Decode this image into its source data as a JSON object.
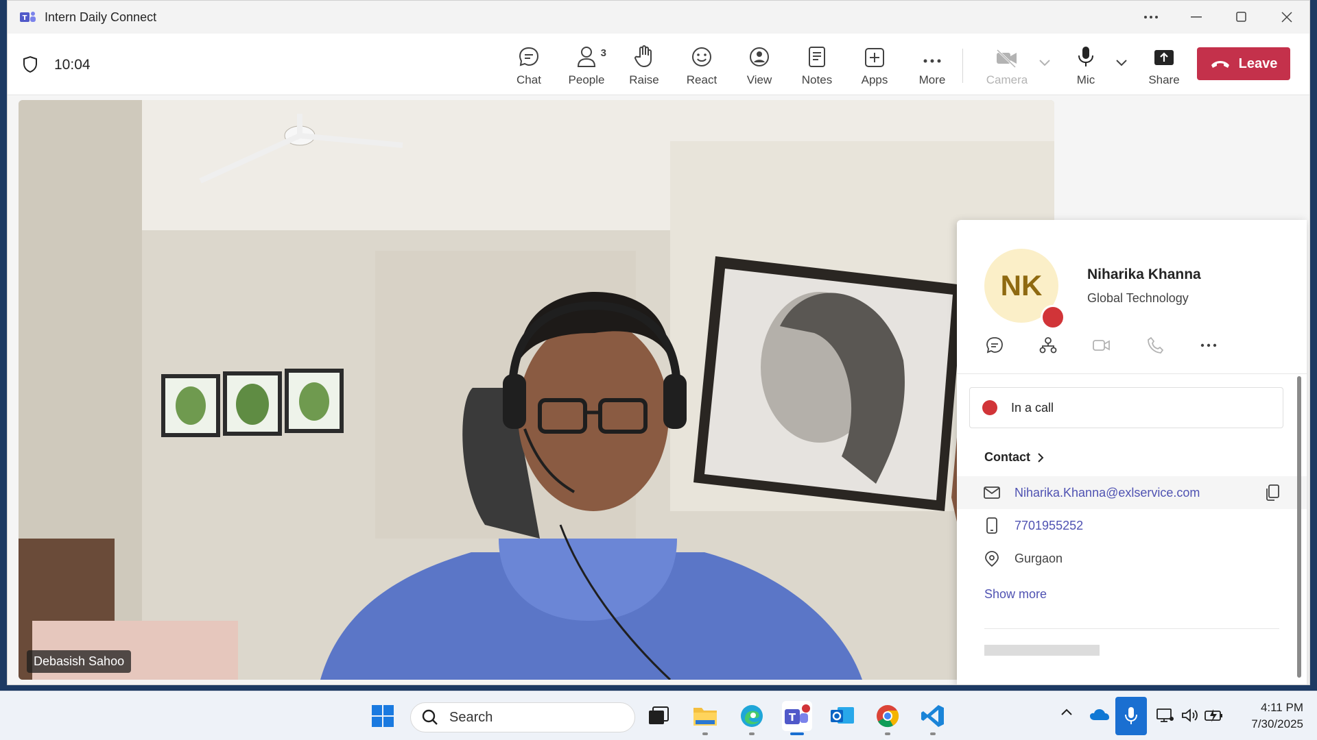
{
  "window": {
    "title": "Intern Daily Connect"
  },
  "toolbar": {
    "time": "10:04",
    "buttons": {
      "chat": "Chat",
      "people": "People",
      "people_count": "3",
      "raise": "Raise",
      "react": "React",
      "view": "View",
      "notes": "Notes",
      "apps": "Apps",
      "more": "More",
      "camera": "Camera",
      "mic": "Mic",
      "share": "Share"
    },
    "leave": "Leave"
  },
  "video": {
    "participant_name": "Debasish Sahoo"
  },
  "profile_card": {
    "initials": "NK",
    "name": "Niharika Khanna",
    "department": "Global Technology",
    "status": "In a call",
    "contact_header": "Contact",
    "email": "Niharika.Khanna@exlservice.com",
    "phone": "7701955252",
    "location": "Gurgaon",
    "show_more": "Show more"
  },
  "taskbar": {
    "search_label": "Search",
    "time": "4:11 PM",
    "date": "7/30/2025"
  },
  "colors": {
    "leave": "#c4314b",
    "presence_busy": "#d13438",
    "accent": "#4f52b2",
    "avatar_bg": "#fbefc8"
  }
}
